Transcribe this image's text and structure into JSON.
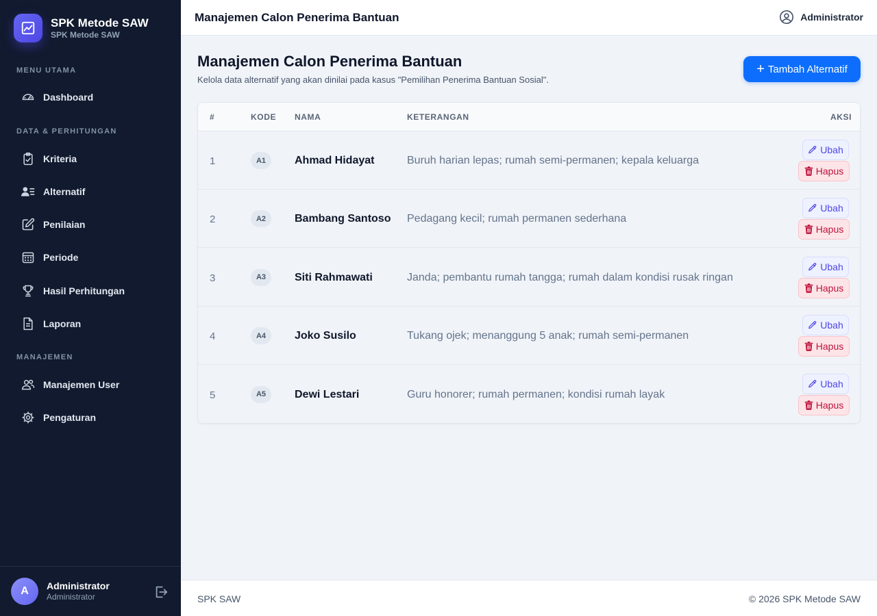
{
  "brand": {
    "title": "SPK Metode SAW",
    "subtitle": "SPK Metode SAW",
    "logo_icon": "trending-chart-icon",
    "accent": "#4f46e5"
  },
  "sidebar": {
    "sections": [
      {
        "label": "MENU UTAMA",
        "items": [
          {
            "label": "Dashboard",
            "icon": "gauge-icon"
          }
        ]
      },
      {
        "label": "DATA & PERHITUNGAN",
        "items": [
          {
            "label": "Kriteria",
            "icon": "clipboard-check-icon"
          },
          {
            "label": "Alternatif",
            "icon": "users-list-icon"
          },
          {
            "label": "Penilaian",
            "icon": "pencil-square-icon"
          },
          {
            "label": "Periode",
            "icon": "calendar-icon"
          },
          {
            "label": "Hasil Perhitungan",
            "icon": "trophy-icon"
          },
          {
            "label": "Laporan",
            "icon": "document-icon"
          }
        ]
      },
      {
        "label": "MANAJEMEN",
        "items": [
          {
            "label": "Manajemen User",
            "icon": "people-icon"
          },
          {
            "label": "Pengaturan",
            "icon": "gear-icon"
          }
        ]
      }
    ],
    "user": {
      "initial": "A",
      "name": "Administrator",
      "role": "Administrator"
    }
  },
  "topbar": {
    "title": "Manajemen Calon Penerima Bantuan",
    "user_label": "Administrator"
  },
  "main": {
    "title": "Manajemen Calon Penerima Bantuan",
    "subtitle": "Kelola data alternatif yang akan dinilai pada kasus \"Pemilihan Penerima Bantuan Sosial\".",
    "add_button": "Tambah Alternatif",
    "table": {
      "headers": {
        "no": "#",
        "code": "KODE",
        "name": "NAMA",
        "desc": "KETERANGAN",
        "action": "AKSI"
      },
      "edit_label": "Ubah",
      "delete_label": "Hapus",
      "rows": [
        {
          "no": "1",
          "code": "A1",
          "name": "Ahmad Hidayat",
          "desc": "Buruh harian lepas; rumah semi-permanen; kepala keluarga"
        },
        {
          "no": "2",
          "code": "A2",
          "name": "Bambang Santoso",
          "desc": "Pedagang kecil; rumah permanen sederhana"
        },
        {
          "no": "3",
          "code": "A3",
          "name": "Siti Rahmawati",
          "desc": "Janda; pembantu rumah tangga; rumah dalam kondisi rusak ringan"
        },
        {
          "no": "4",
          "code": "A4",
          "name": "Joko Susilo",
          "desc": "Tukang ojek; menanggung 5 anak; rumah semi-permanen"
        },
        {
          "no": "5",
          "code": "A5",
          "name": "Dewi Lestari",
          "desc": "Guru honorer; rumah permanen; kondisi rumah layak"
        }
      ]
    }
  },
  "footer": {
    "left": "SPK SAW",
    "right": "© 2026 SPK Metode SAW"
  }
}
